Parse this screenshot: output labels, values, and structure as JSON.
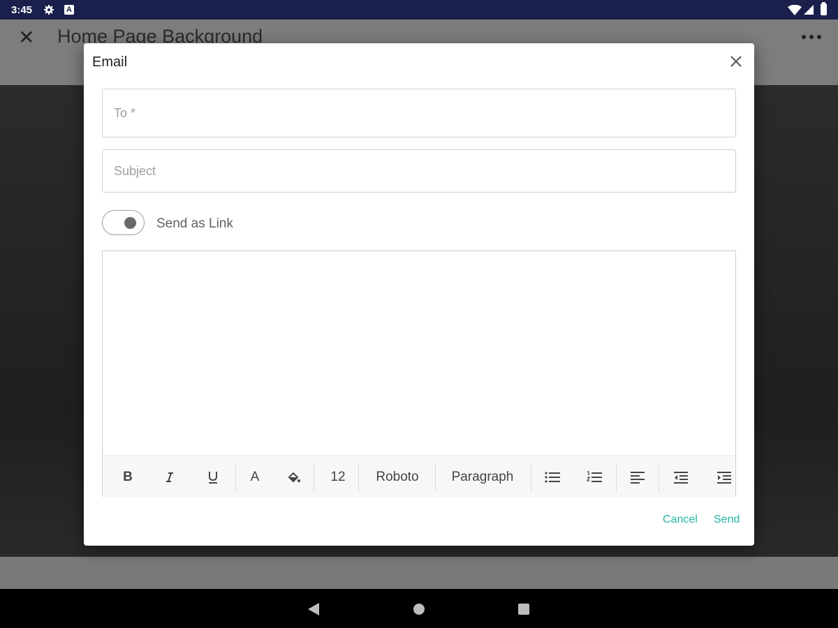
{
  "status_bar": {
    "time": "3:45",
    "gear_icon": "gear-icon",
    "notification_icon": "A"
  },
  "app": {
    "title": "Home Page Background",
    "close_icon": "close-icon",
    "more_icon": "more-icon"
  },
  "dialog": {
    "title": "Email",
    "to": {
      "placeholder": "To *",
      "value": ""
    },
    "subject": {
      "placeholder": "Subject",
      "value": ""
    },
    "send_as_link": {
      "label": "Send as Link",
      "on": false
    },
    "body": "",
    "toolbar": {
      "font_size": "12",
      "font_family": "Roboto",
      "block_format": "Paragraph",
      "bold_label": "B",
      "font_color_label": "A"
    },
    "cancel_label": "Cancel",
    "send_label": "Send"
  },
  "colors": {
    "accent": "#22b5a6",
    "status_bar": "#1b1f4b",
    "toggle_knob": "#6a6a6a"
  }
}
